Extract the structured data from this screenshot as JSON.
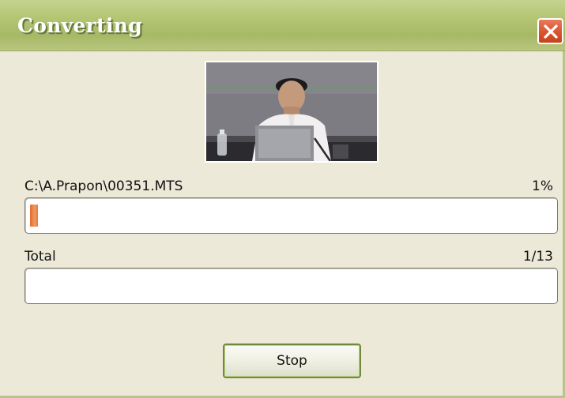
{
  "window": {
    "title": "Converting",
    "close_icon": "close-icon"
  },
  "current_file": {
    "path": "C:\\A.Prapon\\00351.MTS",
    "percent_label": "1%",
    "progress": 0.01
  },
  "total": {
    "label": "Total",
    "count_label": "1/13",
    "progress": 0.0
  },
  "actions": {
    "stop_label": "Stop"
  },
  "colors": {
    "title_bar": "#b4c574",
    "close_button": "#d9532e",
    "progress_fill": "#e36a2c",
    "dialog_background": "#ece9d8"
  }
}
